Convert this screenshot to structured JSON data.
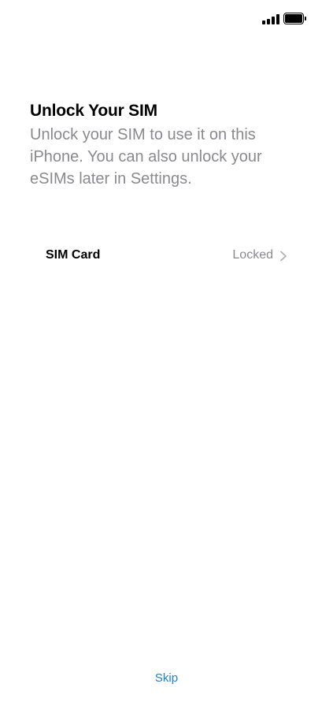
{
  "header": {
    "title": "Unlock Your SIM",
    "subtitle": "Unlock your SIM to use it on this iPhone. You can also unlock your eSIMs later in Settings."
  },
  "sim_row": {
    "label": "SIM Card",
    "status": "Locked",
    "icon": "chevron-right-icon"
  },
  "footer": {
    "skip_label": "Skip"
  },
  "colors": {
    "accent": "#1e7fd0",
    "secondary_text": "#8a8a8e",
    "primary_text": "#000000"
  }
}
